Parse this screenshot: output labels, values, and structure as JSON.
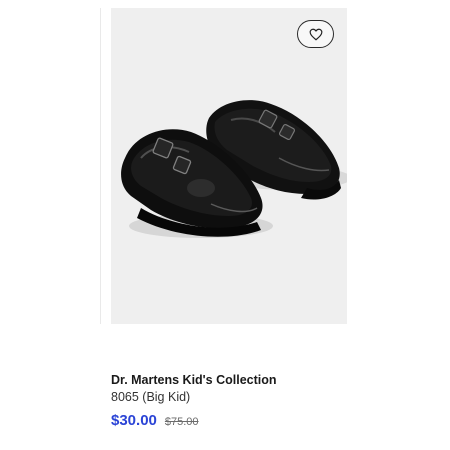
{
  "product": {
    "brand": "Dr. Martens Kid's Collection",
    "model": "8065 (Big Kid)",
    "price": "$30.00",
    "original_price": "$75.00",
    "image": "black patent leather mary jane shoes",
    "favorite_icon": "heart-outline-icon"
  },
  "colors": {
    "price": "#2b44d6",
    "card_background": "#efefef"
  }
}
